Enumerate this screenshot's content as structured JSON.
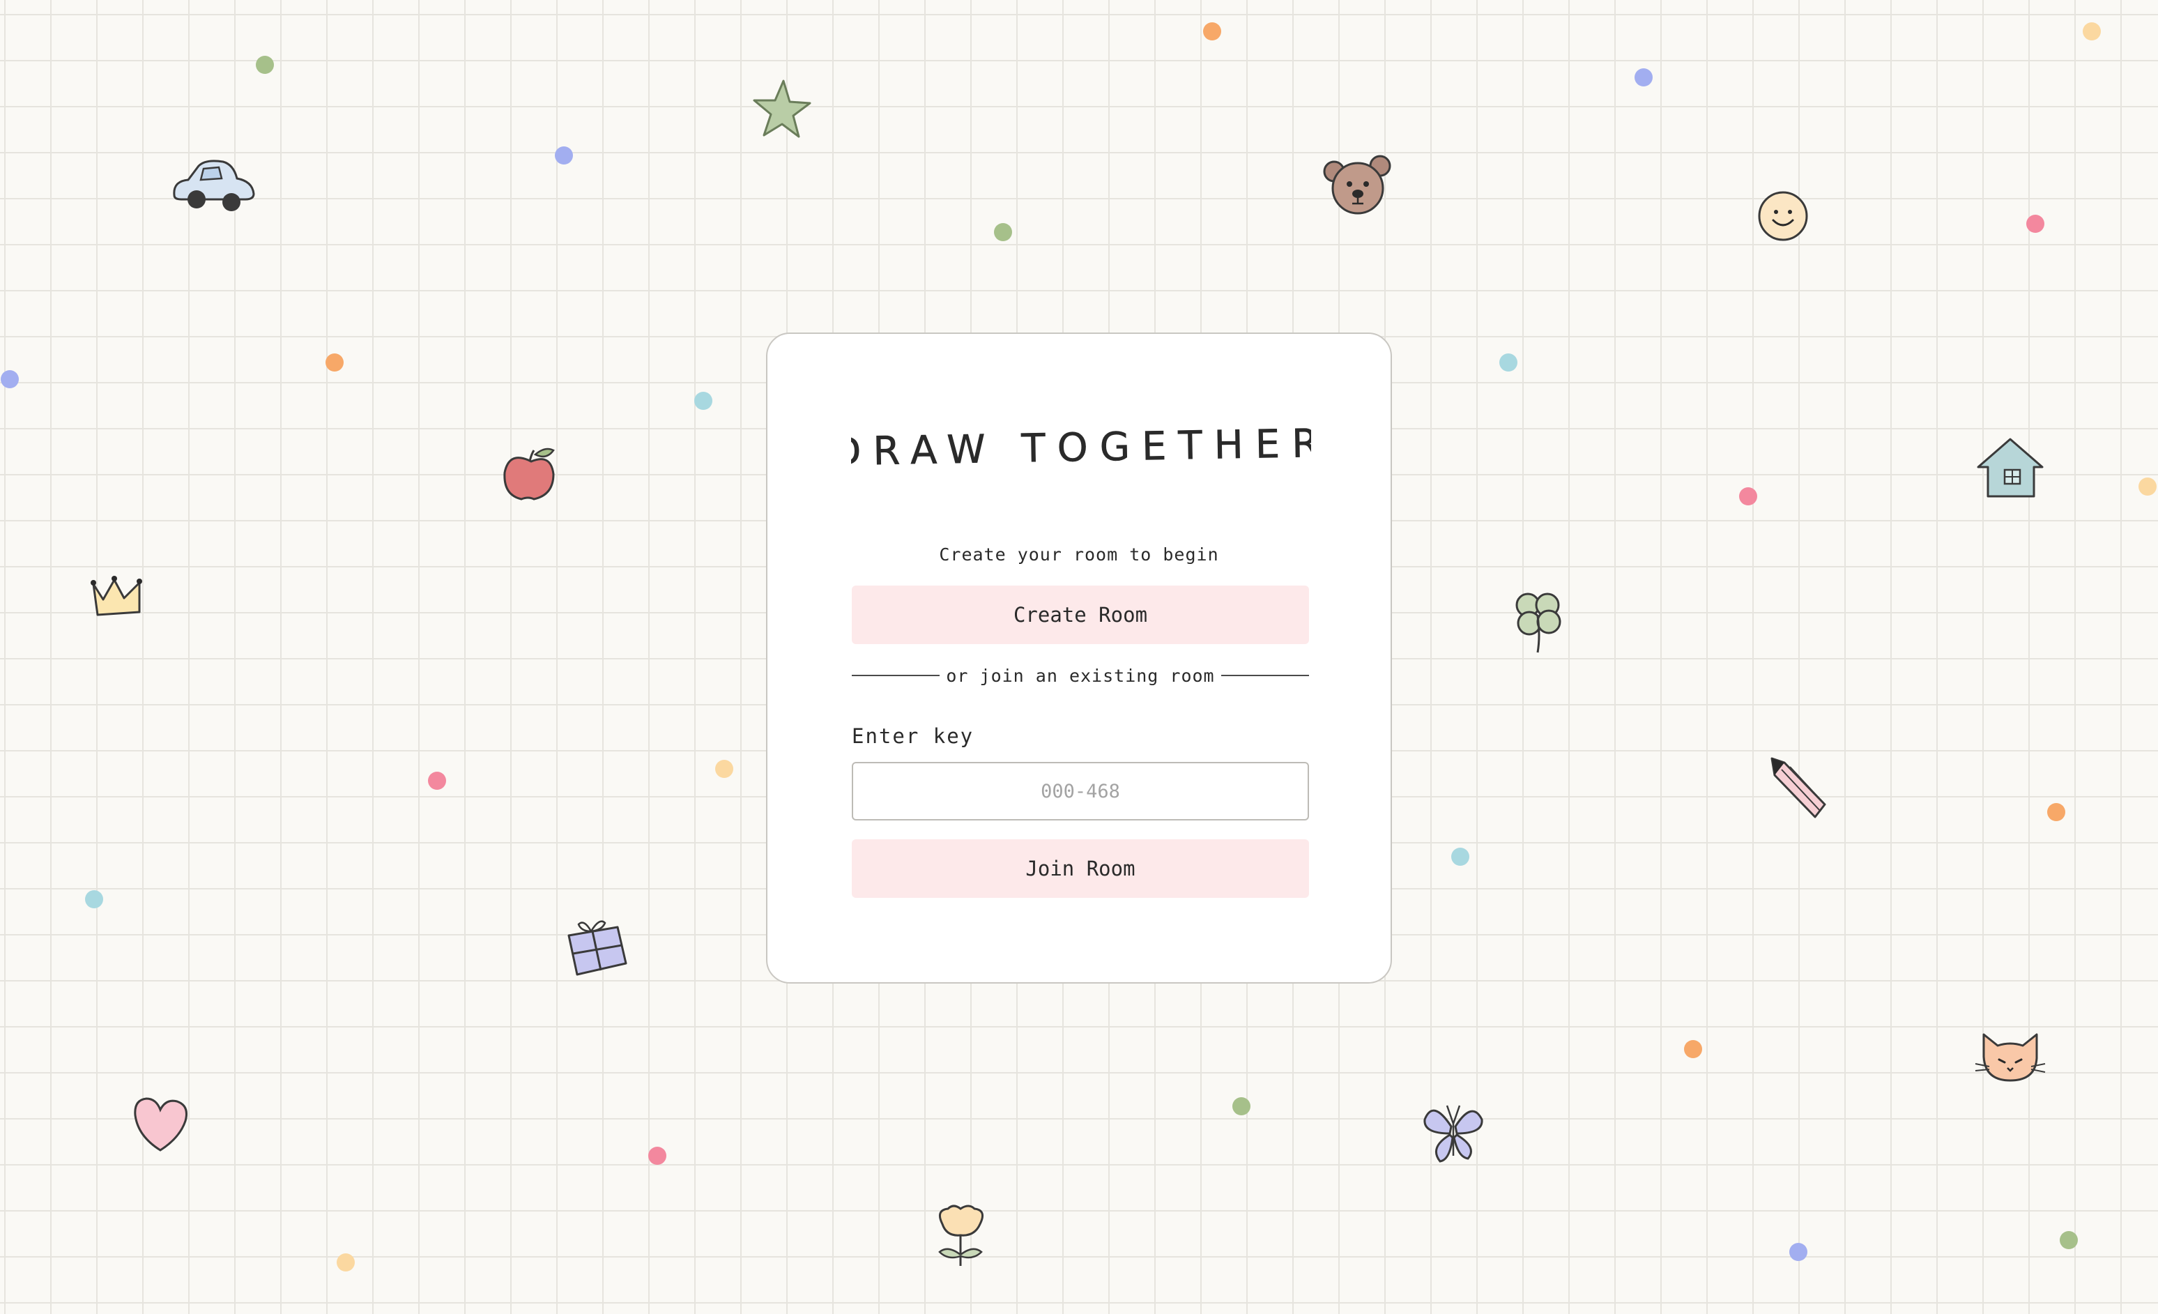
{
  "app": {
    "title": "DRAW TOGETHER",
    "subtitle": "Create your room to begin"
  },
  "create": {
    "button_label": "Create Room"
  },
  "divider": {
    "text": "or join an existing room"
  },
  "join": {
    "key_label": "Enter key",
    "key_value": "",
    "key_placeholder": "000-468",
    "button_label": "Join Room"
  },
  "colors": {
    "background": "#faf9f5",
    "grid": "#e6e4de",
    "card": "#ffffff",
    "button": "#fde9ea",
    "text": "#2a2a2a",
    "dot_palette": [
      "#a2aef0",
      "#a6c08a",
      "#f7a868",
      "#a8d8e0",
      "#f3889e",
      "#fbd8a0"
    ]
  },
  "doodles": [
    "car-icon",
    "star-icon",
    "bear-icon",
    "smiley-icon",
    "apple-icon",
    "house-icon",
    "crown-icon",
    "clover-icon",
    "pencil-icon",
    "gift-icon",
    "cat-icon",
    "heart-icon",
    "butterfly-icon",
    "flower-icon"
  ]
}
